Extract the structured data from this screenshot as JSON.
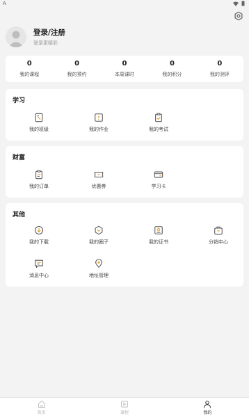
{
  "status": {
    "left_glyph": "A"
  },
  "profile": {
    "title": "登录/注册",
    "subtitle": "登录更精彩"
  },
  "stats": [
    {
      "value": "0",
      "label": "我的课程"
    },
    {
      "value": "0",
      "label": "我的预约"
    },
    {
      "value": "0",
      "label": "本周课时"
    },
    {
      "value": "0",
      "label": "我的积分"
    },
    {
      "value": "0",
      "label": "我的测评"
    }
  ],
  "study": {
    "title": "学习",
    "items": [
      {
        "label": "我的班级",
        "icon": "class-icon"
      },
      {
        "label": "我的作业",
        "icon": "homework-icon"
      },
      {
        "label": "我的考试",
        "icon": "exam-icon"
      }
    ]
  },
  "wealth": {
    "title": "财富",
    "items": [
      {
        "label": "我的订单",
        "icon": "order-icon"
      },
      {
        "label": "优惠券",
        "icon": "coupon-icon"
      },
      {
        "label": "学习卡",
        "icon": "card-icon"
      }
    ]
  },
  "other": {
    "title": "其他",
    "items": [
      {
        "label": "我的下载",
        "icon": "download-icon"
      },
      {
        "label": "我的圈子",
        "icon": "circle-icon"
      },
      {
        "label": "我的证书",
        "icon": "certificate-icon"
      },
      {
        "label": "分销中心",
        "icon": "distribution-icon"
      },
      {
        "label": "消息中心",
        "icon": "message-icon"
      },
      {
        "label": "地址管理",
        "icon": "location-icon"
      }
    ]
  },
  "tabs": [
    {
      "label": "首页",
      "icon": "home-icon"
    },
    {
      "label": "课程",
      "icon": "course-icon"
    },
    {
      "label": "我的",
      "icon": "user-icon"
    }
  ],
  "colors": {
    "accent": "#e8a33d",
    "background": "#f3f3f4",
    "card": "#ffffff"
  }
}
